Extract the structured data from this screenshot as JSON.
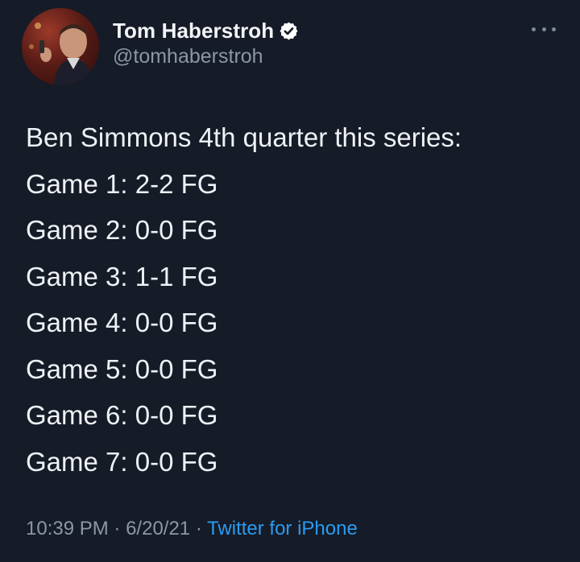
{
  "tweet": {
    "author": {
      "display_name": "Tom Haberstroh",
      "handle": "@tomhaberstroh",
      "verified_icon": "verified-badge-icon",
      "avatar": "author-avatar"
    },
    "more_icon": "more-horizontal-icon",
    "lines": [
      "Ben Simmons 4th quarter this series:",
      "Game 1: 2-2 FG",
      "Game 2: 0-0 FG",
      "Game 3: 1-1 FG",
      "Game 4: 0-0 FG",
      "Game 5: 0-0 FG",
      "Game 6: 0-0 FG",
      "Game 7: 0-0 FG"
    ],
    "meta": {
      "time": "10:39 PM",
      "separator": "·",
      "date": "6/20/21",
      "source": "Twitter for iPhone"
    }
  },
  "colors": {
    "background": "#151b27",
    "text": "#eef1f5",
    "secondary_text": "#8b97a6",
    "link": "#2b9bf0"
  }
}
